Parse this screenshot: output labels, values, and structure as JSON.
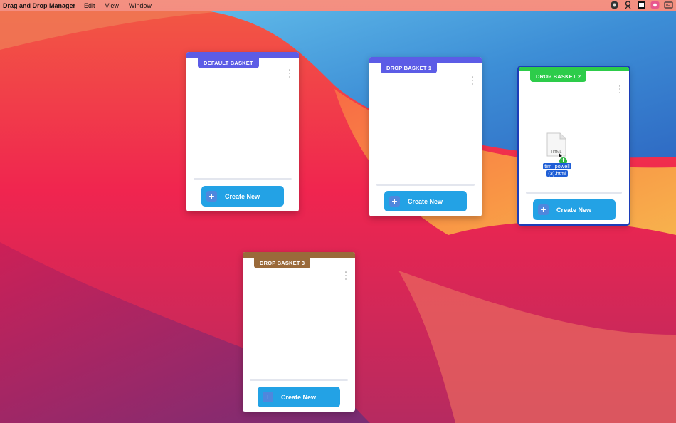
{
  "menubar": {
    "app_name": "Drag and Drop Manager",
    "menus": [
      "Edit",
      "View",
      "Window"
    ],
    "tray_icons": [
      "app-status-icon",
      "accessibility-icon",
      "display-icon",
      "camera-icon",
      "screenshot-icon"
    ]
  },
  "baskets": [
    {
      "title": "DEFAULT BASKET",
      "color": "#5c5ce6",
      "button_label": "Create New"
    },
    {
      "title": "DROP BASKET 1",
      "color": "#5c5ce6",
      "button_label": "Create New"
    },
    {
      "title": "DROP BASKET 2",
      "color": "#2dcc4a",
      "button_label": "Create New",
      "drop_target_active": true
    },
    {
      "title": "DROP BASKET 3",
      "color": "#9a6a3a",
      "button_label": "Create New"
    }
  ],
  "dragged_file": {
    "doc_label": "HTML",
    "name_line1": "tim_powell",
    "name_line2": "(3).html",
    "badge": "+"
  },
  "colors": {
    "button": "#23a2e5",
    "button_icon_bg": "#4f87dd",
    "active_outline": "#1c3db8"
  }
}
